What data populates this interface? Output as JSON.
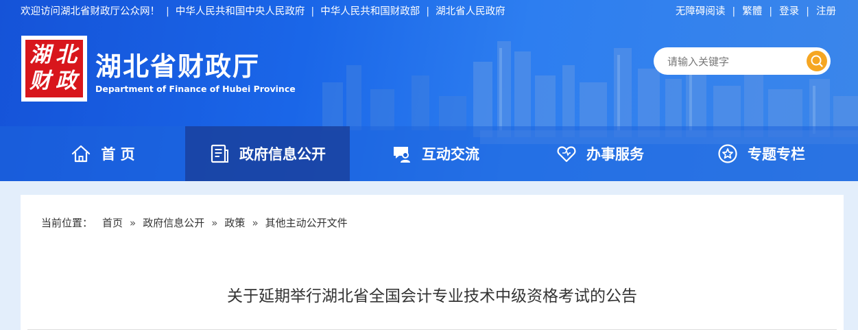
{
  "topbar": {
    "links": [
      "欢迎访问湖北省财政厅公众网！",
      "中华人民共和国中央人民政府",
      "中华人民共和国财政部",
      "湖北省人民政府"
    ],
    "right_links": [
      "无障碍阅读",
      "繁體",
      "登录",
      "注册"
    ],
    "separator": "|"
  },
  "logo": {
    "seal_chars": [
      "湖",
      "北",
      "财",
      "政"
    ],
    "title": "湖北省财政厅",
    "subtitle": "Department of Finance of Hubei Province"
  },
  "search": {
    "placeholder": "请输入关键字",
    "icon": "search-icon"
  },
  "nav": {
    "items": [
      {
        "label": "首 页",
        "icon": "home-icon"
      },
      {
        "label": "政府信息公开",
        "icon": "document-icon"
      },
      {
        "label": "互动交流",
        "icon": "chat-user-icon"
      },
      {
        "label": "办事服务",
        "icon": "heart-icon"
      },
      {
        "label": "专题专栏",
        "icon": "star-circle-icon"
      }
    ],
    "active_index": 1
  },
  "breadcrumb": {
    "label": "当前位置：",
    "items": [
      "首页",
      "政府信息公开",
      "政策",
      "其他主动公开文件"
    ],
    "separator": "»"
  },
  "article": {
    "title": "关于延期举行湖北省全国会计专业技术中级资格考试的公告"
  },
  "colors": {
    "header_blue": "#1a66e8",
    "seal_red": "#d8161c",
    "search_button": "#f5a623",
    "page_bg": "#e3eefb"
  }
}
